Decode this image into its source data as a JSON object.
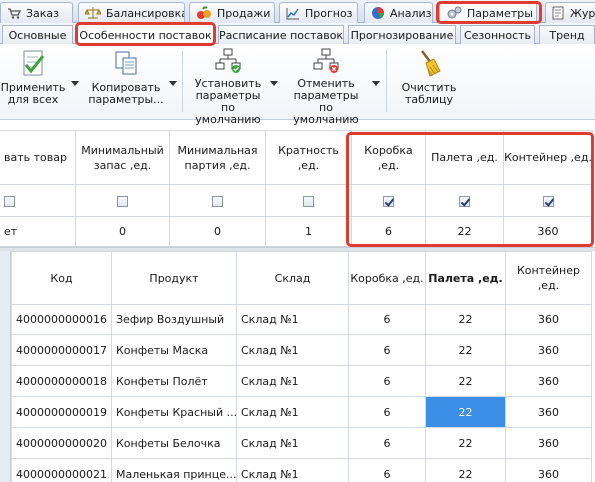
{
  "main_tabs": [
    {
      "label": "Заказ",
      "icon": "cart-icon"
    },
    {
      "label": "Балансировка",
      "icon": "scales-icon"
    },
    {
      "label": "Продажи",
      "icon": "fruit-icon"
    },
    {
      "label": "Прогноз",
      "icon": "line-chart-icon"
    },
    {
      "label": "Анализ",
      "icon": "pie-chart-icon"
    },
    {
      "label": "Параметры",
      "icon": "gears-icon",
      "active": true
    },
    {
      "label": "Журн",
      "icon": "journal-icon"
    }
  ],
  "sub_tabs": [
    {
      "label": "Основные"
    },
    {
      "label": "Особенности поставок",
      "active": true
    },
    {
      "label": "Расписание поставок"
    },
    {
      "label": "Прогнозирование"
    },
    {
      "label": "Сезонность"
    },
    {
      "label": "Тренд"
    }
  ],
  "ribbon": {
    "apply_all": "Применить\nдля всех",
    "copy_params": "Копировать\nпараметры...",
    "set_defaults": "Установить\nпараметры\nпо умолчанию",
    "cancel_defaults": "Отменить\nпараметры\nпо умолчанию",
    "clear_table": "Очистить\nтаблицу"
  },
  "params_grid": {
    "headers": [
      "вать товар",
      "Минимальный запас ,ед.",
      "Минимальная партия ,ед.",
      "Кратность ,ед.",
      "Коробка ,ед.",
      "Палета ,ед.",
      "Контейнер ,ед."
    ],
    "checkboxes": [
      false,
      false,
      false,
      false,
      true,
      true,
      true
    ],
    "values": [
      "ет",
      "0",
      "0",
      "1",
      "6",
      "22",
      "360"
    ]
  },
  "products_grid": {
    "headers": [
      "Код",
      "Продукт",
      "Склад",
      "Коробка ,ед.",
      "Палета ,ед.",
      "Контейнер ,ед."
    ],
    "rows": [
      {
        "code": "4000000000016",
        "product": "Зефир Воздушный",
        "store": "Склад №1",
        "box": "6",
        "pallet": "22",
        "container": "360"
      },
      {
        "code": "4000000000017",
        "product": "Конфеты Маска",
        "store": "Склад №1",
        "box": "6",
        "pallet": "22",
        "container": "360"
      },
      {
        "code": "4000000000018",
        "product": "Конфеты Полёт",
        "store": "Склад №1",
        "box": "6",
        "pallet": "22",
        "container": "360"
      },
      {
        "code": "4000000000019",
        "product": "Конфеты Красный ...",
        "store": "Склад №1",
        "box": "6",
        "pallet": "22",
        "container": "360",
        "selected_cell": "pallet"
      },
      {
        "code": "4000000000020",
        "product": "Конфеты Белочка",
        "store": "Склад №1",
        "box": "6",
        "pallet": "22",
        "container": "360"
      },
      {
        "code": "4000000000021",
        "product": "Маленькая принце...",
        "store": "Склад №1",
        "box": "6",
        "pallet": "22",
        "container": "360"
      }
    ]
  },
  "colors": {
    "highlight": "#e03b32",
    "selection": "#3c8ee6"
  }
}
